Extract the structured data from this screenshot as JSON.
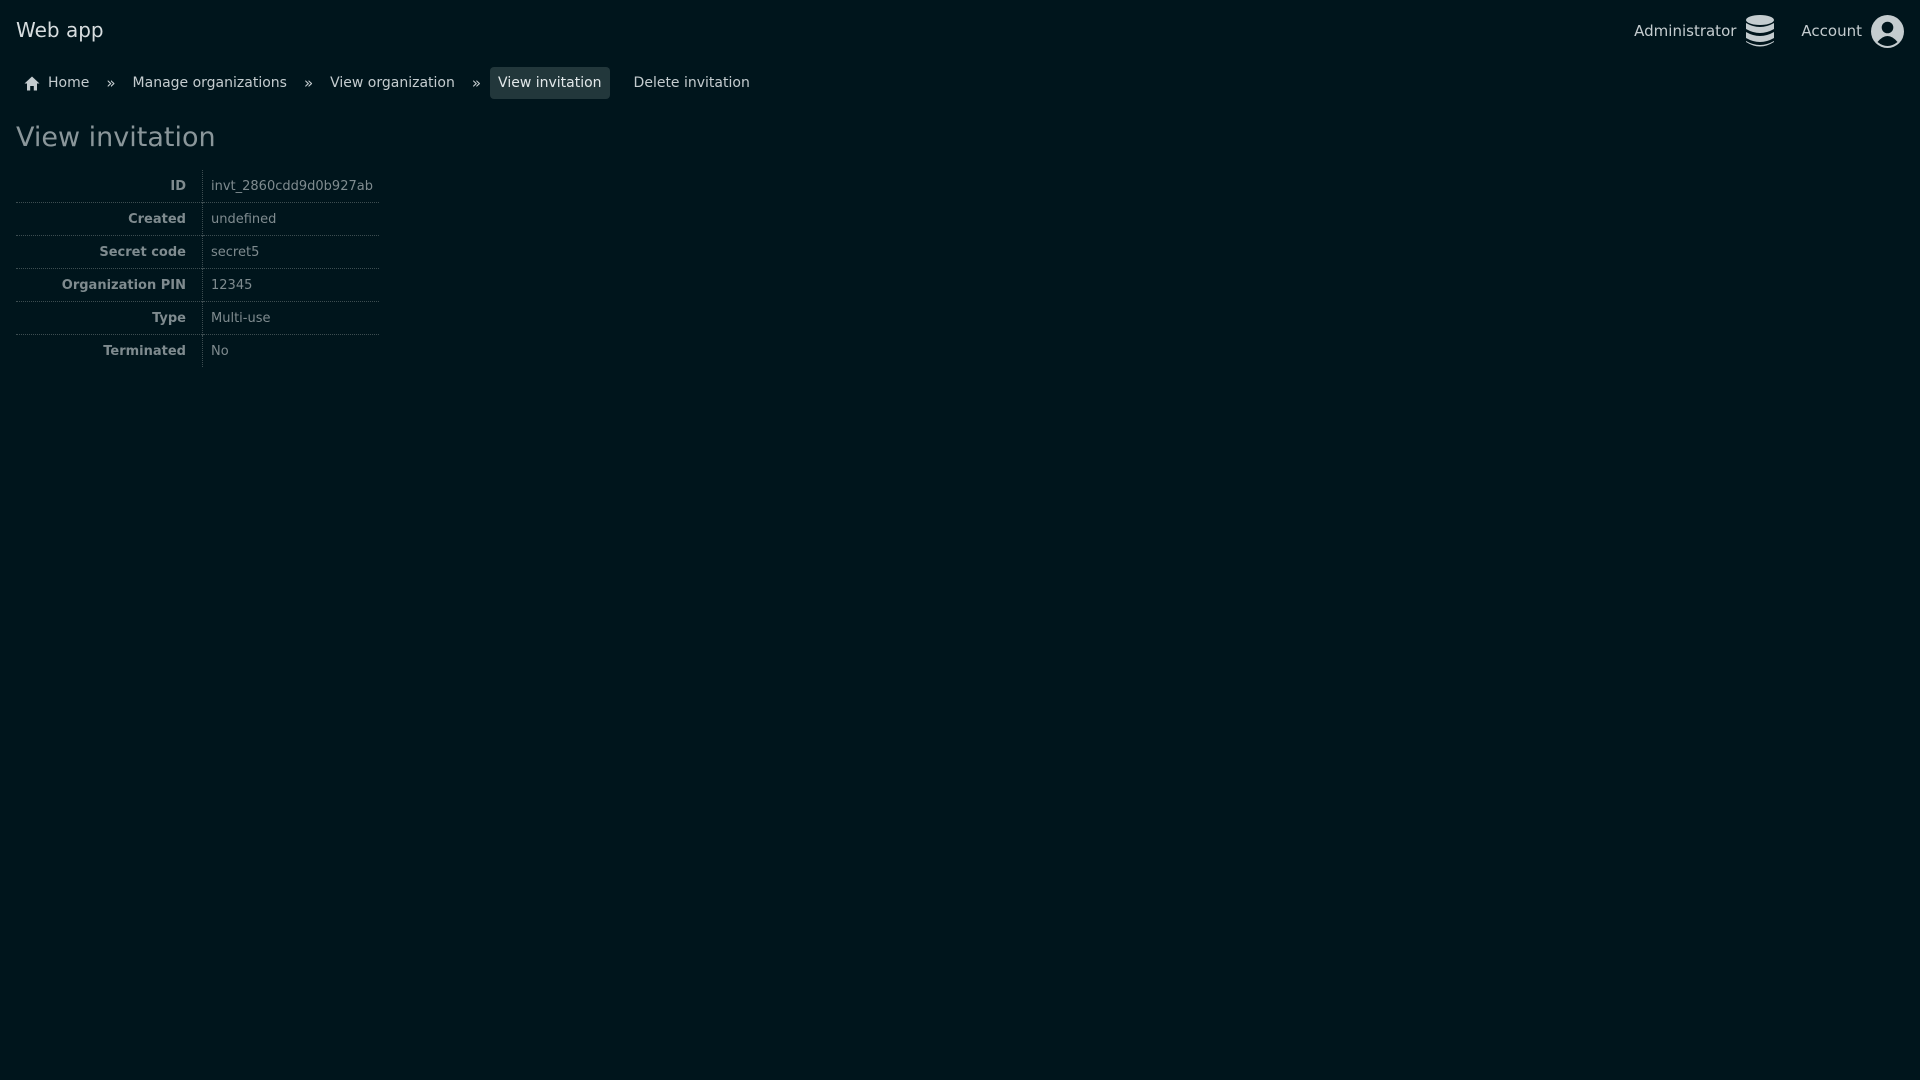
{
  "header": {
    "app_title": "Web app",
    "admin_label": "Administrator",
    "admin_icon": "database-icon",
    "account_label": "Account",
    "account_icon": "user-circle-icon"
  },
  "breadcrumb": {
    "home_icon": "home-icon",
    "items": [
      {
        "label": "Home"
      },
      {
        "label": "Manage organizations"
      },
      {
        "label": "View organization"
      },
      {
        "label": "View invitation",
        "active": true
      }
    ],
    "separator": "»",
    "action_label": "Delete invitation"
  },
  "page": {
    "title": "View invitation"
  },
  "details": [
    {
      "key": "ID",
      "value": "invt_2860cdd9d0b927ab"
    },
    {
      "key": "Created",
      "value": "undefined"
    },
    {
      "key": "Secret code",
      "value": "secret5"
    },
    {
      "key": "Organization PIN",
      "value": "12345"
    },
    {
      "key": "Type",
      "value": "Multi-use"
    },
    {
      "key": "Terminated",
      "value": "No"
    }
  ],
  "colors": {
    "background": "#00151c",
    "active_crumb": "#22373b",
    "muted_text": "#7f8b8f"
  }
}
